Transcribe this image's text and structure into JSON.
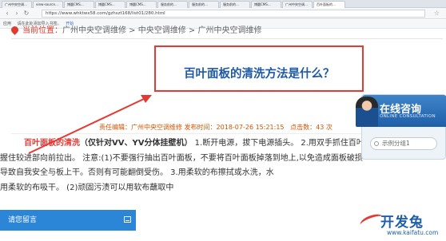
{
  "browser": {
    "tabs": [
      "广州中央空调…",
      "view-source…",
      "博圆CMS…",
      "博圆CMS…",
      "博圆CMS…",
      "服务前的…",
      "服务前的…",
      "服务前的…",
      "博圆CMS…",
      "广州中央空调…",
      "百叶面板的…"
    ],
    "url": "https://www.whktwx58.com/gzhszt168/list01/280.html",
    "bookmark_label": "应用",
    "bookmark_hint": "请在此处添加导入书签。",
    "bookmark_link": "开始"
  },
  "breadcrumb": {
    "prefix": "当前位置：",
    "items": [
      "广州中央空调维修",
      "中央空调维修",
      "广州中央空调维修"
    ],
    "separator": " > "
  },
  "article": {
    "title": "百叶面板的清洗方法是什么？",
    "meta": {
      "editor_label": "责任编辑：",
      "editor": "广州中央空调维修",
      "time_label": "发布时间：",
      "time": "2018-07-26 15:21:15",
      "hits_label": "点击数：",
      "hits": "43 次"
    },
    "lead_highlight": "百叶面板的清洗",
    "lead_bold": "（仅针对VV、YV分体挂壁机）",
    "line1_rest": " 1.断开电源，拔下电源插头。  2.用双手抓住百叶",
    "line2": "握住较进部向前拉出。   注意:(1)不要强行抽出百叶面板，不要将百叶面板掉落到地上,以免造成面板破损",
    "line3": "导致自我安全与板上干。否则有可能翻倒受伤。   3.用柔软的布擦拭或水洗，水",
    "line4": "用柔软的布吸干。   (2)顽固污渍可以用软布蘸取中"
  },
  "consult_widget": {
    "title": "在线咨询",
    "subtitle": "ONLINE CONSULTATION",
    "demo_button": "示例分组1"
  },
  "message_bar": {
    "label": "请您留言"
  },
  "watermark": {
    "text": "开发兔",
    "url": "www.kaifatu.com"
  },
  "colors": {
    "accent_red": "#e53935",
    "title_blue": "#1e59a6",
    "meta_orange": "#d35400",
    "message_blue": "#2c86d8"
  }
}
